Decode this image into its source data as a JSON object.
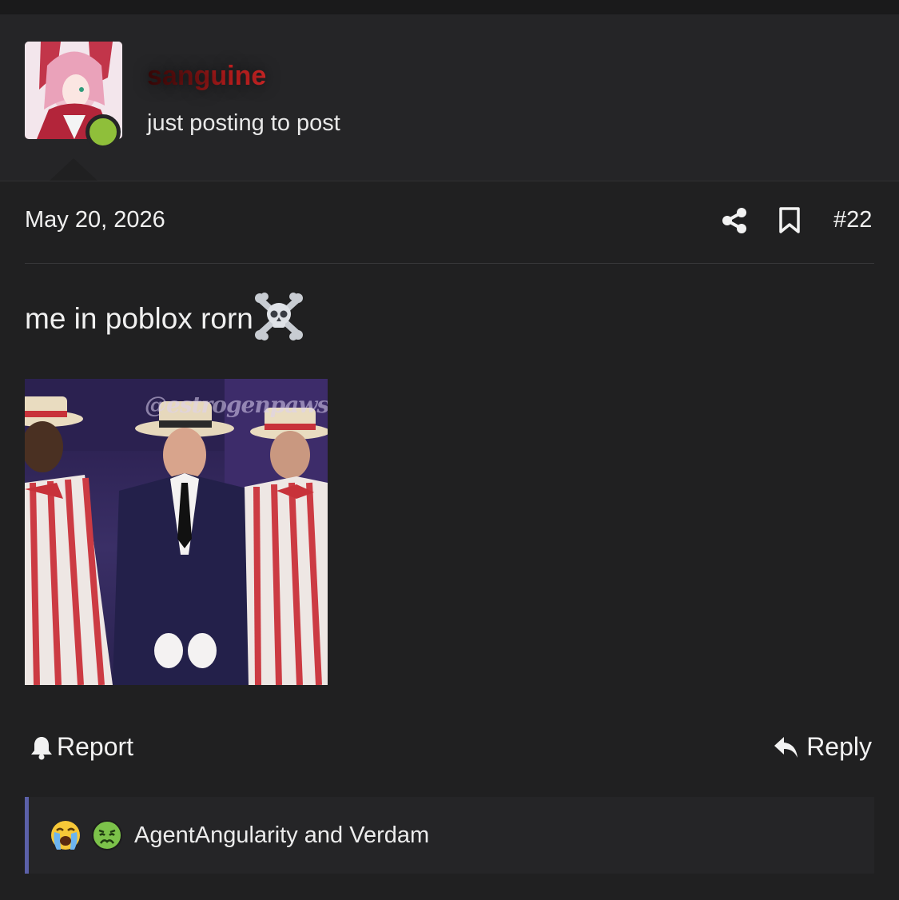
{
  "user": {
    "name": "sanguine",
    "title": "just posting to post",
    "avatar_icon": "avatar-image",
    "online_color": "#8fbf3a"
  },
  "post": {
    "date": "May 20, 2026",
    "number": "#22",
    "body_text": "me in poblox rorn",
    "body_emoji": "skull-and-crossbones-icon",
    "image_watermark": "@estrogenpaws"
  },
  "actions": {
    "report_label": "Report",
    "reply_label": "Reply"
  },
  "reactions": {
    "emojis": [
      "loudly-crying-face-icon",
      "nauseated-face-icon"
    ],
    "text": "AgentAngularity and Verdam",
    "accent": "#5b60a8"
  }
}
